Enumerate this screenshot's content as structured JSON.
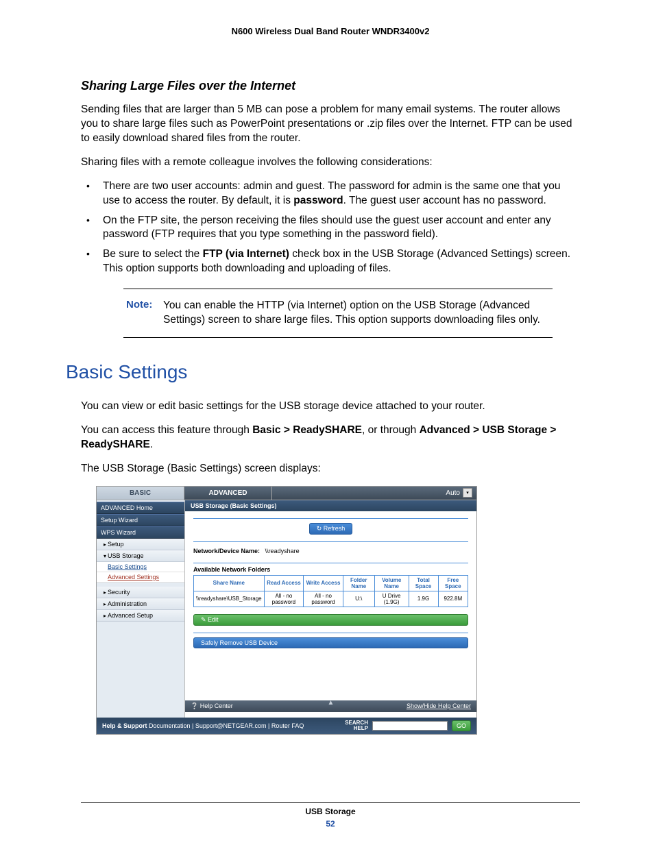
{
  "header": {
    "title": "N600 Wireless Dual Band Router WNDR3400v2"
  },
  "section_sharing": {
    "title": "Sharing Large Files over the Internet",
    "p1": "Sending files that are larger than 5 MB can pose a problem for many email systems. The router allows you to share large files such as PowerPoint presentations or .zip files over the Internet. FTP can be used to easily download shared files from the router.",
    "p2": "Sharing files with a remote colleague involves the following considerations:",
    "bullets": [
      {
        "pre": "There are two user accounts: admin and guest. The password for admin is the same one that you use to access the router. By default, it is ",
        "bold": "password",
        "post": ". The guest user account has no password."
      },
      {
        "pre": "On the FTP site, the person receiving the files should use the guest user account and enter any password (FTP requires that you type something in the password field).",
        "bold": "",
        "post": ""
      },
      {
        "pre": "Be sure to select the ",
        "bold": "FTP (via Internet)",
        "post": " check box in the USB Storage (Advanced Settings) screen. This option supports both downloading and uploading of files."
      }
    ],
    "note_label": "Note:",
    "note_text": "You can enable the HTTP (via Internet) option on the USB Storage (Advanced Settings) screen to share large files. This option supports downloading files only."
  },
  "section_basic": {
    "title": "Basic Settings",
    "p1": "You can view or edit basic settings for the USB storage device attached to your router.",
    "p2_pre": "You can access this feature through ",
    "p2_b1": "Basic > ReadySHARE",
    "p2_mid": ", or through ",
    "p2_b2": "Advanced > USB Storage > ReadySHARE",
    "p2_post": ".",
    "p3": "The USB Storage (Basic Settings) screen displays:"
  },
  "screenshot": {
    "tabs": {
      "basic": "BASIC",
      "advanced": "ADVANCED",
      "auto": "Auto"
    },
    "sidebar": {
      "items": [
        {
          "label": "ADVANCED Home",
          "type": "dark"
        },
        {
          "label": "Setup Wizard",
          "type": "dark"
        },
        {
          "label": "WPS Wizard",
          "type": "dark"
        },
        {
          "label": "Setup",
          "type": "plain",
          "tri": "▸"
        },
        {
          "label": "USB Storage",
          "type": "plain",
          "tri": "▾"
        },
        {
          "label": "Basic Settings",
          "type": "sub"
        },
        {
          "label": "Advanced Settings",
          "type": "subsel"
        },
        {
          "label": "Security",
          "type": "plain",
          "tri": "▸"
        },
        {
          "label": "Administration",
          "type": "plain",
          "tri": "▸"
        },
        {
          "label": "Advanced Setup",
          "type": "plain",
          "tri": "▸"
        }
      ]
    },
    "main": {
      "title": "USB Storage (Basic Settings)",
      "refresh": "Refresh",
      "device_label": "Network/Device Name:",
      "device_value": "\\\\readyshare",
      "table_title": "Available Network Folders",
      "headers": [
        "Share Name",
        "Read Access",
        "Write Access",
        "Folder Name",
        "Volume Name",
        "Total Space",
        "Free Space"
      ],
      "row": [
        "\\\\readyshare\\USB_Storage",
        "All - no password",
        "All - no password",
        "U:\\",
        "U Drive (1.9G)",
        "1.9G",
        "922.8M"
      ],
      "edit": "Edit",
      "remove": "Safely Remove USB Device",
      "help_center": "Help Center",
      "help_toggle": "Show/Hide Help Center"
    },
    "footer": {
      "left_bold": "Help & Support",
      "left_rest": " Documentation | Support@NETGEAR.com | Router FAQ",
      "search_label1": "SEARCH",
      "search_label2": "HELP",
      "go": "GO"
    }
  },
  "footer": {
    "section": "USB Storage",
    "page": "52"
  }
}
